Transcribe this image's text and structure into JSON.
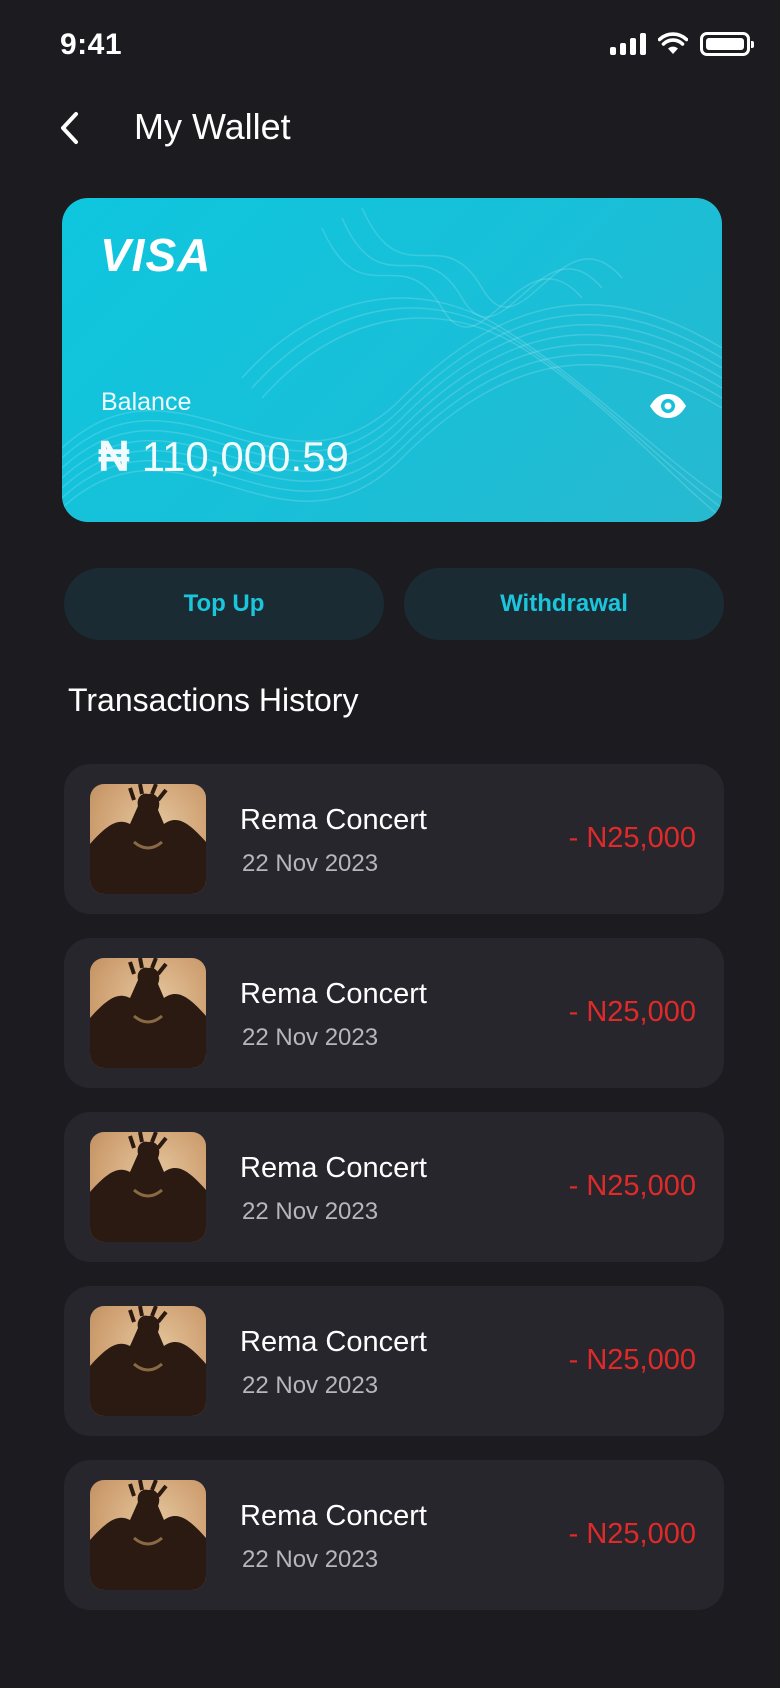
{
  "status_bar": {
    "time": "9:41"
  },
  "header": {
    "title": "My Wallet"
  },
  "card": {
    "brand": "VISA",
    "balance_label": "Balance",
    "currency_symbol": "₦",
    "balance_value": "110,000.59"
  },
  "actions": {
    "top_up_label": "Top Up",
    "withdrawal_label": "Withdrawal"
  },
  "transactions_title": "Transactions History",
  "transactions": [
    {
      "name": "Rema Concert",
      "date": "22 Nov 2023",
      "amount": "- N25,000"
    },
    {
      "name": "Rema Concert",
      "date": "22 Nov 2023",
      "amount": "- N25,000"
    },
    {
      "name": "Rema Concert",
      "date": "22 Nov 2023",
      "amount": "- N25,000"
    },
    {
      "name": "Rema Concert",
      "date": "22 Nov 2023",
      "amount": "- N25,000"
    },
    {
      "name": "Rema Concert",
      "date": "22 Nov 2023",
      "amount": "- N25,000"
    }
  ],
  "colors": {
    "background": "#1c1b20",
    "card": "#12c3dc",
    "accent": "#1bc6dd",
    "button_bg": "#1b2b33",
    "item_bg": "#27262c",
    "debit": "#e02a2a"
  },
  "icons": {
    "back": "chevron-left-icon",
    "eye": "eye-icon",
    "signal": "signal-icon",
    "wifi": "wifi-icon",
    "battery": "battery-icon"
  }
}
